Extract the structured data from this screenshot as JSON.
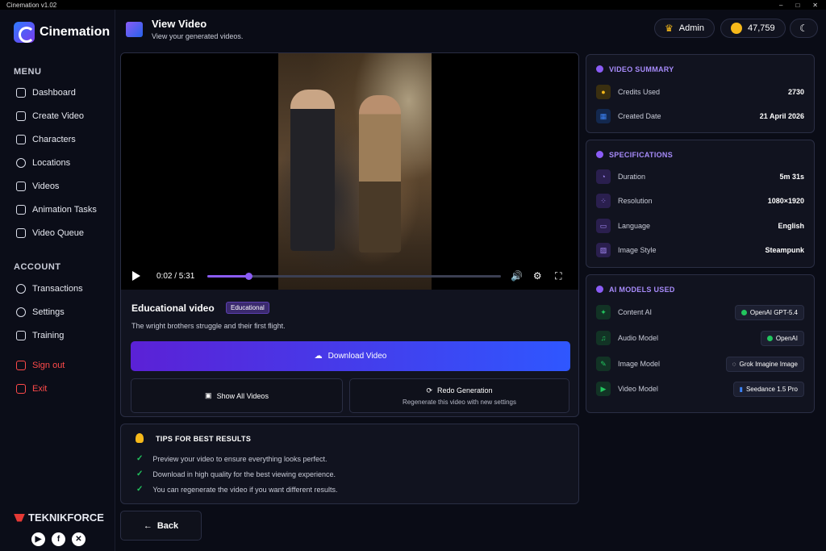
{
  "window": {
    "title": "Cinemation v1.02",
    "controls": [
      "–",
      "□",
      "✕"
    ]
  },
  "sidebar": {
    "app_name": "Cinemation",
    "menu_label": "MENU",
    "menu_items": [
      {
        "label": "Dashboard",
        "icon": "gauge-icon"
      },
      {
        "label": "Create Video",
        "icon": "edit-icon"
      },
      {
        "label": "Characters",
        "icon": "users-icon"
      },
      {
        "label": "Locations",
        "icon": "map-pin-icon"
      },
      {
        "label": "Videos",
        "icon": "calendar-icon"
      },
      {
        "label": "Animation Tasks",
        "icon": "tasks-icon"
      },
      {
        "label": "Video Queue",
        "icon": "queue-icon"
      }
    ],
    "account_label": "ACCOUNT",
    "account_items": [
      {
        "label": "Transactions",
        "icon": "people-icon"
      },
      {
        "label": "Settings",
        "icon": "gear-icon"
      },
      {
        "label": "Training",
        "icon": "book-icon"
      }
    ],
    "sign_out": "Sign out",
    "exit": "Exit",
    "brand": "TEKNIKFORCE",
    "socials": [
      "youtube-icon",
      "facebook-icon",
      "x-icon"
    ]
  },
  "header": {
    "title": "View Video",
    "subtitle": "View your generated videos.",
    "user": "Admin",
    "credits": "47,759"
  },
  "player": {
    "current_time": "0:02",
    "duration": "5:31",
    "time_display": "0:02 / 5:31",
    "progress": 0.14
  },
  "video": {
    "title": "Educational video",
    "tag": "Educational",
    "description": "The wright brothers struggle and their first flight.",
    "download_label": "Download Video",
    "show_all_label": "Show All Videos",
    "redo_label": "Redo Generation",
    "redo_sub": "Regenerate this video with new settings"
  },
  "tips": {
    "title": "TIPS FOR BEST RESULTS",
    "items": [
      "Preview your video to ensure everything looks perfect.",
      "Download in high quality for the best viewing experience.",
      "You can regenerate the video if you want different results."
    ]
  },
  "back_label": "Back",
  "summary": {
    "title": "VIDEO SUMMARY",
    "rows": [
      {
        "key": "Credits Used",
        "value": "2730"
      },
      {
        "key": "Created Date",
        "value": "21 April 2026"
      }
    ]
  },
  "specs": {
    "title": "SPECIFICATIONS",
    "rows": [
      {
        "key": "Duration",
        "value": "5m 31s"
      },
      {
        "key": "Resolution",
        "value": "1080×1920"
      },
      {
        "key": "Language",
        "value": "English"
      },
      {
        "key": "Image Style",
        "value": "Steampunk"
      }
    ]
  },
  "models": {
    "title": "AI MODELS USED",
    "rows": [
      {
        "key": "Content AI",
        "value": "OpenAI GPT-5.4"
      },
      {
        "key": "Audio Model",
        "value": "OpenAI"
      },
      {
        "key": "Image Model",
        "value": "Grok Imagine Image"
      },
      {
        "key": "Video Model",
        "value": "Seedance 1.5 Pro"
      }
    ]
  }
}
